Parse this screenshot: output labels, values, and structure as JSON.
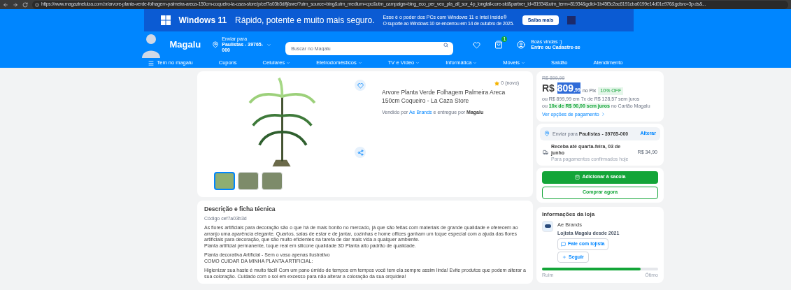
{
  "browser": {
    "url": "https://www.magazineluiza.com.br/arvore-planta-verde-folhagem-palmeira-areca-150cm-coqueiro-la-caza-store/p/cef7a03b3d/fj/avre/?utm_source=bing&utm_medium=cpc&utm_campaign=bing_eco_per_veo_pla_all_sor_4p_longtail-core-std&partner_id=81934&utm_term=81934&gclid=1b45f3c2ac6191cba0199e14d01e976&gclsrc=3p.ds&..."
  },
  "banner": {
    "brand": "Windows 11",
    "headline": "Rápido, potente e muito mais seguro.",
    "subtitle": "Esse é o poder dos PCs com Windows 11 e Intel Inside®",
    "note": "O suporte ao Windows 10 se encerrou em 14 de outubro de 2025.",
    "button": "Saiba mais"
  },
  "header": {
    "logo": "Magalu",
    "delivery_label": "Enviar para",
    "delivery_place": "Paulistas - 39765-000",
    "search": {
      "placeholder": "Buscar no Magalu"
    },
    "bag_count": "1",
    "greeting": "Boas vindas :)",
    "login": "Entre ou Cadastre-se"
  },
  "nav": [
    {
      "label": "Tem no magalu",
      "dropdown": false,
      "menu": true
    },
    {
      "label": "Cupons",
      "dropdown": false,
      "menu": false
    },
    {
      "label": "Celulares",
      "dropdown": true,
      "menu": false
    },
    {
      "label": "Eletrodomésticos",
      "dropdown": true,
      "menu": false
    },
    {
      "label": "TV e Vídeo",
      "dropdown": true,
      "menu": false
    },
    {
      "label": "Informática",
      "dropdown": true,
      "menu": false
    },
    {
      "label": "Móveis",
      "dropdown": true,
      "menu": false
    },
    {
      "label": "Saldão",
      "dropdown": false,
      "menu": false
    },
    {
      "label": "Atendimento",
      "dropdown": false,
      "menu": false
    }
  ],
  "product": {
    "rating": "0 (novo)",
    "title": "Arvore Planta Verde Folhagem Palmeira Areca 150cm Coqueiro - La Caza Store",
    "seller_prefix": "Vendido por",
    "seller": "Ae Brands",
    "seller_mid": "e entregue por",
    "deliverer": "Magalu",
    "thumbnails": [
      {
        "selected": true
      },
      {
        "selected": false
      },
      {
        "selected": false
      }
    ]
  },
  "price": {
    "old": "R$ 899,99",
    "currency": "R$",
    "main": "809",
    "cents": ",99",
    "pix": "no Pix",
    "discount": "10% OFF",
    "installments": "ou R$ 899,99 em 7x de R$ 128,57 sem juros",
    "offer_prefix": "ou",
    "offer": "10x de R$ 90,00 sem juros",
    "offer_suffix": "no Cartão Magalu",
    "more": "Ver opções de pagamento"
  },
  "shipping": {
    "label": "Enviar para",
    "place": "Paulistas - 39765-000",
    "change": "Alterar",
    "eta": "Receba até quarta-feira, 03 de junho",
    "cost": "R$ 34,90",
    "note": "Para pagamentos confirmados hoje"
  },
  "actions": {
    "add": "Adicionar à sacola",
    "buy": "Comprar agora"
  },
  "description": {
    "title": "Descrição e ficha técnica",
    "code": "Código cef7a03b3d",
    "paragraphs": [
      "As flores artificiais para decoração são o que há de mais bonito no mercado, já que são feitas com materiais de grande qualidade e oferecem ao arranjo uma aparência elegante. Quartos, salas de estar e de jantar, cozinhas e home offices ganham um toque especial com a ajuda das flores artificiais para decoração, que são muito eficientes na tarefa de dar mais vida a qualquer ambiente.",
      "Planta artificial permanente, toque real em silicone qualidade 3D Planta alto padrão de qualidade.",
      "Planta decorativa Artificial - Sem o vaso apenas ilustrativo",
      "COMO CUIDAR DA MINHA PLANTA ARTIFICIAL:",
      "Higienizar sua haste é muito fácil! Com um pano úmido de tempos em tempos você tem ela sempre assim linda! Evite produtos que podem alterar a sua coloração. Cuidado com o sol em excesso para não alterar a coloração da sua orquidea!"
    ]
  },
  "store": {
    "title": "Informações da loja",
    "name": "Ae Brands",
    "since": "Lojista Magalu desde 2021",
    "chat": "Fale com lojista",
    "follow": "Seguir",
    "reputation": {
      "level": 0.85,
      "low": "Ruim",
      "high": "Ótimo"
    }
  }
}
